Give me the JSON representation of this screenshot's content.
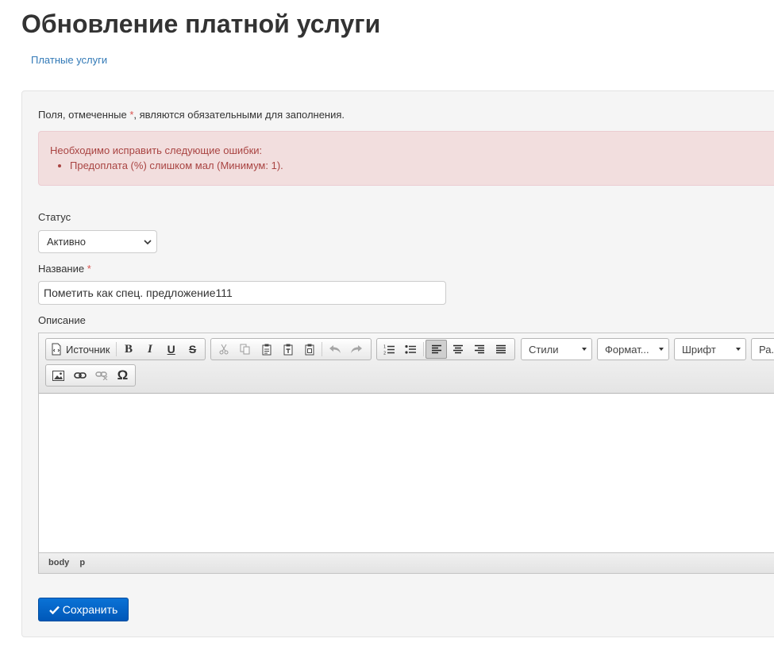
{
  "page": {
    "title": "Обновление платной услуги"
  },
  "breadcrumb": {
    "link": "Платные услуги"
  },
  "form": {
    "required_note_before": "Поля, отмеченные ",
    "required_star": "*",
    "required_note_after": ", являются обязательными для заполнения.",
    "errors": {
      "heading": "Необходимо исправить следующие ошибки:",
      "items": [
        "Предоплата (%) слишком мал (Минимум: 1)."
      ]
    },
    "status": {
      "label": "Статус",
      "value": "Активно"
    },
    "name": {
      "label": "Название",
      "required": "*",
      "value": "Пометить как спец. предложение111"
    },
    "description": {
      "label": "Описание"
    }
  },
  "editor": {
    "source_label": "Источник",
    "combos": {
      "styles": "Стили",
      "format": "Формат...",
      "font": "Шрифт",
      "size": "Ра..."
    },
    "path": [
      "body",
      "p"
    ]
  },
  "actions": {
    "save_label": "Сохранить"
  }
}
